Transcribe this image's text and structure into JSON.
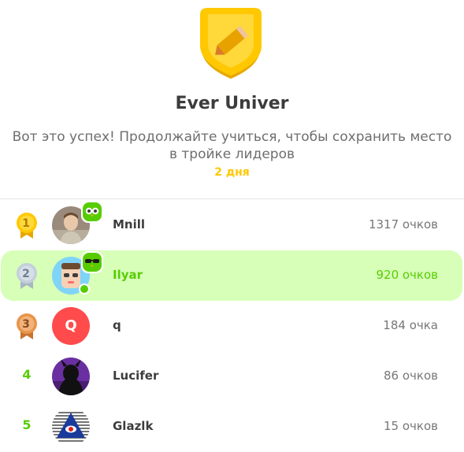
{
  "header": {
    "league_title": "Ever Univer",
    "message": "Вот это успех! Продолжайте учиться, чтобы сохранить место в тройке лидеров",
    "days_left": "2 дня",
    "badge_icon": "pencil-shield-icon"
  },
  "colors": {
    "accent_green": "#58cc02",
    "highlight_bg": "#d7ffb8",
    "gold": "#ffc800",
    "silver": "#c3cfdb",
    "bronze": "#e8944a",
    "avatar_red": "#ff4b4b"
  },
  "leaderboard": [
    {
      "rank": "1",
      "medal": "gold-medal-icon",
      "name": "Mnill",
      "points": "1317 очков",
      "avatar": "photo",
      "streak_badge": true
    },
    {
      "rank": "2",
      "medal": "silver-medal-icon",
      "name": "Ilyar",
      "points": "920 очков",
      "avatar": "cartoon",
      "streak_badge": true,
      "current_user": true,
      "online": true
    },
    {
      "rank": "3",
      "medal": "bronze-medal-icon",
      "name": "q",
      "points": "184 очка",
      "avatar_letter": "Q"
    },
    {
      "rank": "4",
      "name": "Lucifer",
      "points": "86 очков",
      "avatar": "devil"
    },
    {
      "rank": "5",
      "name": "Glazlk",
      "points": "15 очков",
      "avatar": "eye-pyramid"
    }
  ]
}
